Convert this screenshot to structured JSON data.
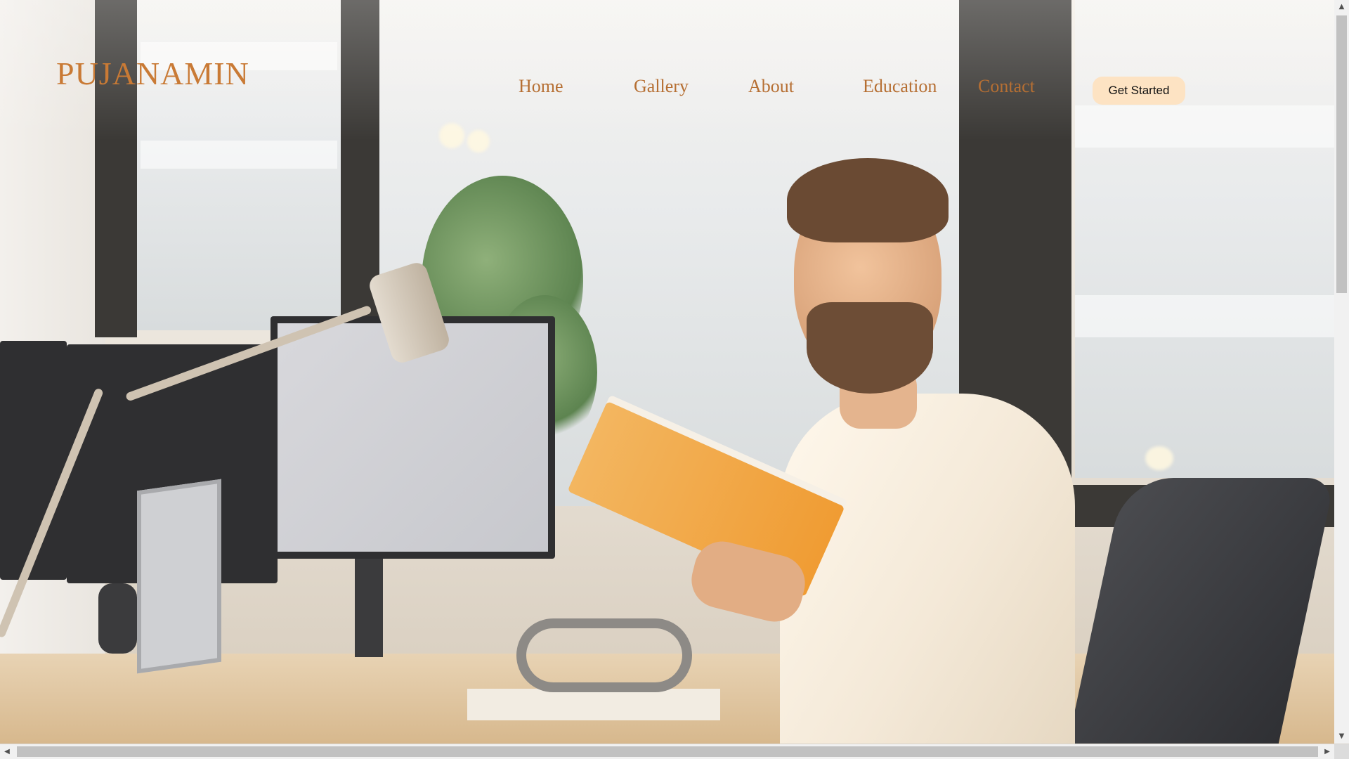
{
  "site": {
    "logo": "PUJANAMIN"
  },
  "nav": {
    "items": [
      {
        "label": "Home"
      },
      {
        "label": "Gallery"
      },
      {
        "label": "About"
      },
      {
        "label": "Education"
      },
      {
        "label": "Contact"
      }
    ],
    "cta_label": "Get Started"
  },
  "hero": {
    "image_icon": "hero-photo-man-reading-book-at-office-desk"
  },
  "colors": {
    "accent": "#c97a35",
    "cta_background": "#fde3c3",
    "cta_text": "#111111"
  },
  "scrollbars": {
    "up_icon": "up-arrow-icon",
    "down_icon": "down-arrow-icon",
    "left_icon": "left-arrow-icon",
    "right_icon": "right-arrow-icon"
  }
}
